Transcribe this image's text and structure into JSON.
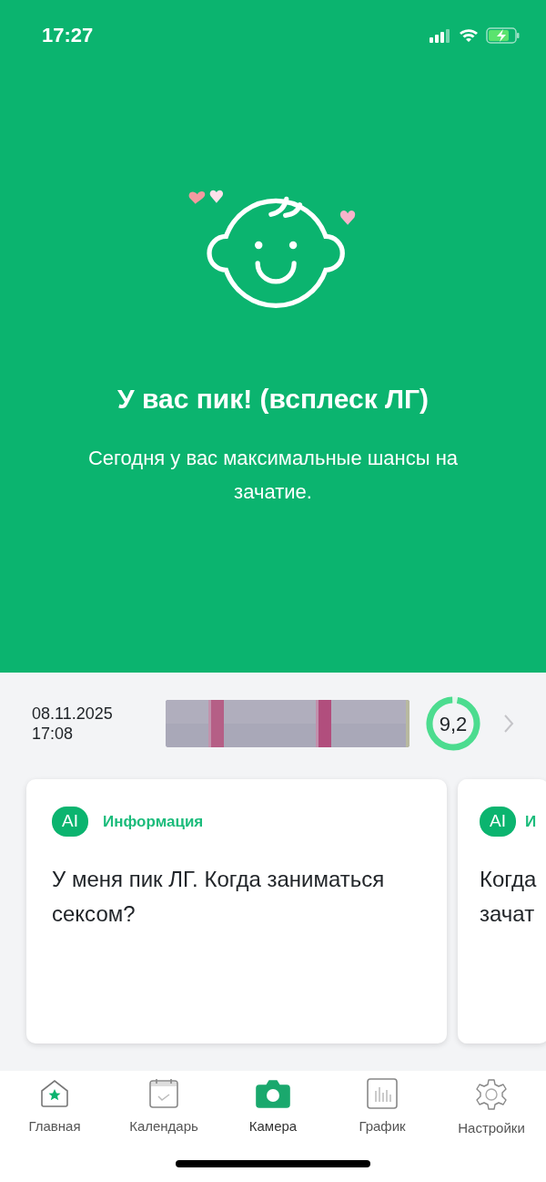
{
  "status_bar": {
    "time": "17:27"
  },
  "hero": {
    "title": "У вас пик! (всплеск ЛГ)",
    "subtitle": "Сегодня у вас максимальные шансы на зачатие."
  },
  "last_test": {
    "date": "08.11.2025",
    "time": "17:08",
    "score": "9,2",
    "level": 0.96
  },
  "cards": [
    {
      "tag": "AI",
      "category": "Информация",
      "question": "У меня пик ЛГ. Когда заниматься сексом?"
    },
    {
      "tag": "AI",
      "category": "И",
      "question": "Когда зачат"
    }
  ],
  "tab_bar": [
    {
      "kind": "home",
      "label": "Главная",
      "selected": false
    },
    {
      "kind": "calendar",
      "label": "Календарь",
      "selected": false
    },
    {
      "kind": "camera",
      "label": "Камера",
      "selected": true
    },
    {
      "kind": "chart",
      "label": "График",
      "selected": false
    },
    {
      "kind": "settings",
      "label": "Настройки",
      "selected": false
    }
  ]
}
